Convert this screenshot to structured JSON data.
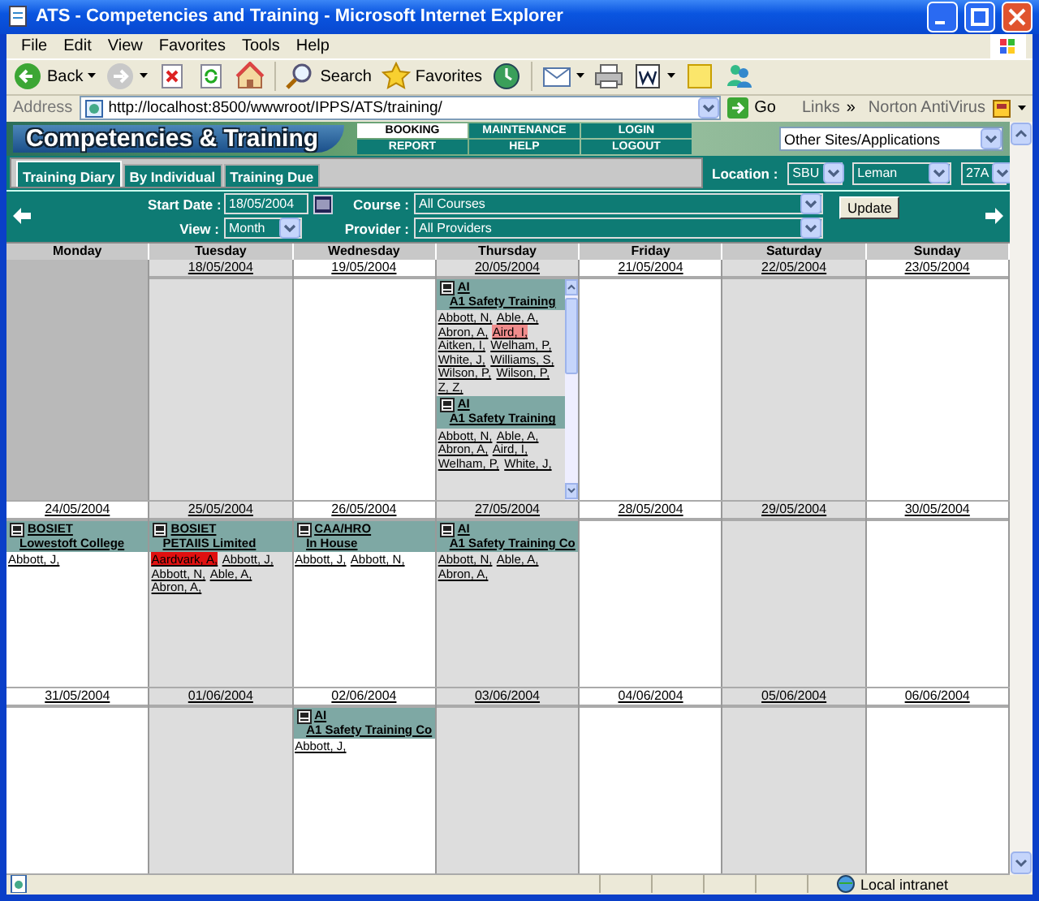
{
  "window": {
    "title": "ATS - Competencies and Training - Microsoft Internet Explorer"
  },
  "menu_bar": [
    "File",
    "Edit",
    "View",
    "Favorites",
    "Tools",
    "Help"
  ],
  "toolbar": [
    {
      "kind": "back",
      "label": "Back",
      "dropdown": true
    },
    {
      "kind": "forward",
      "dropdown": true
    },
    {
      "kind": "stop",
      "dropdown": false
    },
    {
      "kind": "refresh",
      "dropdown": false
    },
    {
      "kind": "home",
      "dropdown": false
    },
    {
      "kind": "search",
      "label": "Search",
      "dropdown": false
    },
    {
      "kind": "favorites",
      "label": "Favorites",
      "dropdown": false
    },
    {
      "kind": "history",
      "dropdown": false
    },
    {
      "kind": "mail",
      "dropdown": true
    },
    {
      "kind": "print",
      "dropdown": false
    },
    {
      "kind": "edit",
      "dropdown": true
    },
    {
      "kind": "notes",
      "dropdown": false
    },
    {
      "kind": "messenger",
      "dropdown": false
    }
  ],
  "address_bar": {
    "label": "Address",
    "url": "http://localhost:8500/wwwroot/IPPS/ATS/training/",
    "go": "Go",
    "links": "Links",
    "chevron": "»",
    "norton": "Norton AntiVirus"
  },
  "app_header": {
    "logo": "Competencies & Training",
    "nav": [
      {
        "label": "BOOKING",
        "selected": true
      },
      {
        "label": "MAINTENANCE",
        "selected": false
      },
      {
        "label": "LOGIN",
        "selected": false
      },
      {
        "label": "REPORT",
        "selected": false
      },
      {
        "label": "HELP",
        "selected": false
      },
      {
        "label": "LOGOUT",
        "selected": false
      }
    ],
    "sites_select": "Other Sites/Applications"
  },
  "tabs": [
    {
      "label": "Training Diary",
      "selected": true
    },
    {
      "label": "By Individual",
      "selected": false
    },
    {
      "label": "Training Due",
      "selected": false
    }
  ],
  "location": {
    "label": "Location :",
    "selects": [
      "SBU",
      "Leman",
      "27A"
    ]
  },
  "filters": {
    "start_date_label": "Start Date :",
    "start_date": "18/05/2004",
    "view_label": "View :",
    "view": "Month",
    "course_label": "Course :",
    "course": "All Courses",
    "provider_label": "Provider :",
    "provider": "All Providers",
    "update": "Update"
  },
  "calendar": {
    "day_names": [
      "Monday",
      "Tuesday",
      "Wednesday",
      "Thursday",
      "Friday",
      "Saturday",
      "Sunday"
    ],
    "weeks": [
      {
        "days": [
          {
            "kind": "outside"
          },
          {
            "kind": "day",
            "date": "18/05/2004"
          },
          {
            "kind": "day",
            "date": "19/05/2004"
          },
          {
            "kind": "day",
            "date": "20/05/2004",
            "scrollable": true,
            "events": [
              {
                "code": "AI",
                "provider": "A1 Safety Training",
                "attendees": [
                  {
                    "name": "Abbott, N,"
                  },
                  {
                    "name": "Able, A,"
                  },
                  {
                    "name": "Abron, A,"
                  },
                  {
                    "name": "Aird, I,",
                    "color": "#f08c8c"
                  },
                  {
                    "name": "Aitken, I,"
                  },
                  {
                    "name": "Welham, P,"
                  },
                  {
                    "name": "White, J,"
                  },
                  {
                    "name": "Williams, S,"
                  },
                  {
                    "name": "Wilson, P,"
                  },
                  {
                    "name": "Wilson, P,"
                  },
                  {
                    "name": "Z, Z,"
                  }
                ]
              },
              {
                "code": "AI",
                "provider": "A1 Safety Training",
                "attendees": [
                  {
                    "name": "Abbott, N,"
                  },
                  {
                    "name": "Able, A,"
                  },
                  {
                    "name": "Abron, A,"
                  },
                  {
                    "name": "Aird, I,"
                  },
                  {
                    "name": "Welham, P,"
                  },
                  {
                    "name": "White, J,"
                  }
                ]
              }
            ]
          },
          {
            "kind": "day",
            "date": "21/05/2004"
          },
          {
            "kind": "day",
            "date": "22/05/2004"
          },
          {
            "kind": "day",
            "date": "23/05/2004"
          }
        ]
      },
      {
        "days": [
          {
            "kind": "day",
            "date": "24/05/2004",
            "events": [
              {
                "code": "BOSIET",
                "provider": "Lowestoft College",
                "attendees": [
                  {
                    "name": "Abbott, J,"
                  }
                ]
              }
            ]
          },
          {
            "kind": "day",
            "date": "25/05/2004",
            "events": [
              {
                "code": "BOSIET",
                "provider": "PETAIIS Limited",
                "attendees": [
                  {
                    "name": "Aardvark, A,",
                    "color": "#e01010"
                  },
                  {
                    "name": "Abbott, J,"
                  },
                  {
                    "name": "Abbott, N,"
                  },
                  {
                    "name": "Able, A,"
                  },
                  {
                    "name": "Abron, A,"
                  }
                ]
              }
            ]
          },
          {
            "kind": "day",
            "date": "26/05/2004",
            "events": [
              {
                "code": "CAA/HRO",
                "provider": "In House",
                "attendees": [
                  {
                    "name": "Abbott, J,"
                  },
                  {
                    "name": "Abbott, N,"
                  }
                ]
              }
            ]
          },
          {
            "kind": "day",
            "date": "27/05/2004",
            "events": [
              {
                "code": "AI",
                "provider": "A1 Safety Training Co",
                "attendees": [
                  {
                    "name": "Abbott, N,"
                  },
                  {
                    "name": "Able, A,"
                  },
                  {
                    "name": "Abron, A,"
                  }
                ]
              }
            ]
          },
          {
            "kind": "day",
            "date": "28/05/2004"
          },
          {
            "kind": "day",
            "date": "29/05/2004"
          },
          {
            "kind": "day",
            "date": "30/05/2004"
          }
        ]
      },
      {
        "days": [
          {
            "kind": "day",
            "date": "31/05/2004"
          },
          {
            "kind": "day",
            "date": "01/06/2004"
          },
          {
            "kind": "day",
            "date": "02/06/2004",
            "events": [
              {
                "code": "AI",
                "provider": "A1 Safety Training Co",
                "attendees": [
                  {
                    "name": "Abbott, J,"
                  }
                ]
              }
            ]
          },
          {
            "kind": "day",
            "date": "03/06/2004"
          },
          {
            "kind": "day",
            "date": "04/06/2004"
          },
          {
            "kind": "day",
            "date": "05/06/2004"
          },
          {
            "kind": "day",
            "date": "06/06/2004"
          }
        ]
      }
    ]
  },
  "status_bar": {
    "zone": "Local intranet"
  }
}
